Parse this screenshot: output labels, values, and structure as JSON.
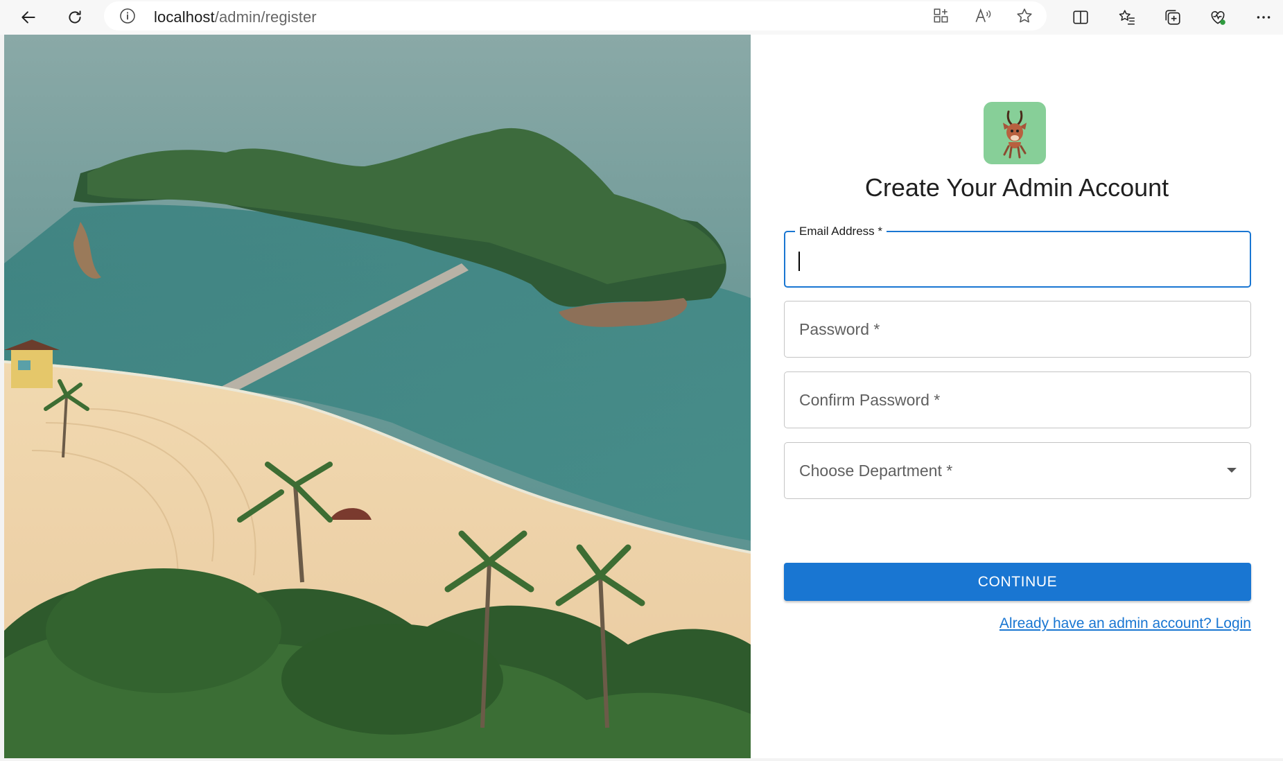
{
  "browser": {
    "url_host": "localhost",
    "url_path": "/admin/register"
  },
  "form": {
    "title": "Create Your Admin Account",
    "email_label": "Email Address *",
    "password_label": "Password *",
    "confirm_label": "Confirm Password *",
    "department_label": "Choose Department *",
    "submit_label": "CONTINUE",
    "login_link": "Already have an admin account? Login"
  },
  "colors": {
    "primary": "#1976d2",
    "logo_bg": "#87cf98"
  }
}
